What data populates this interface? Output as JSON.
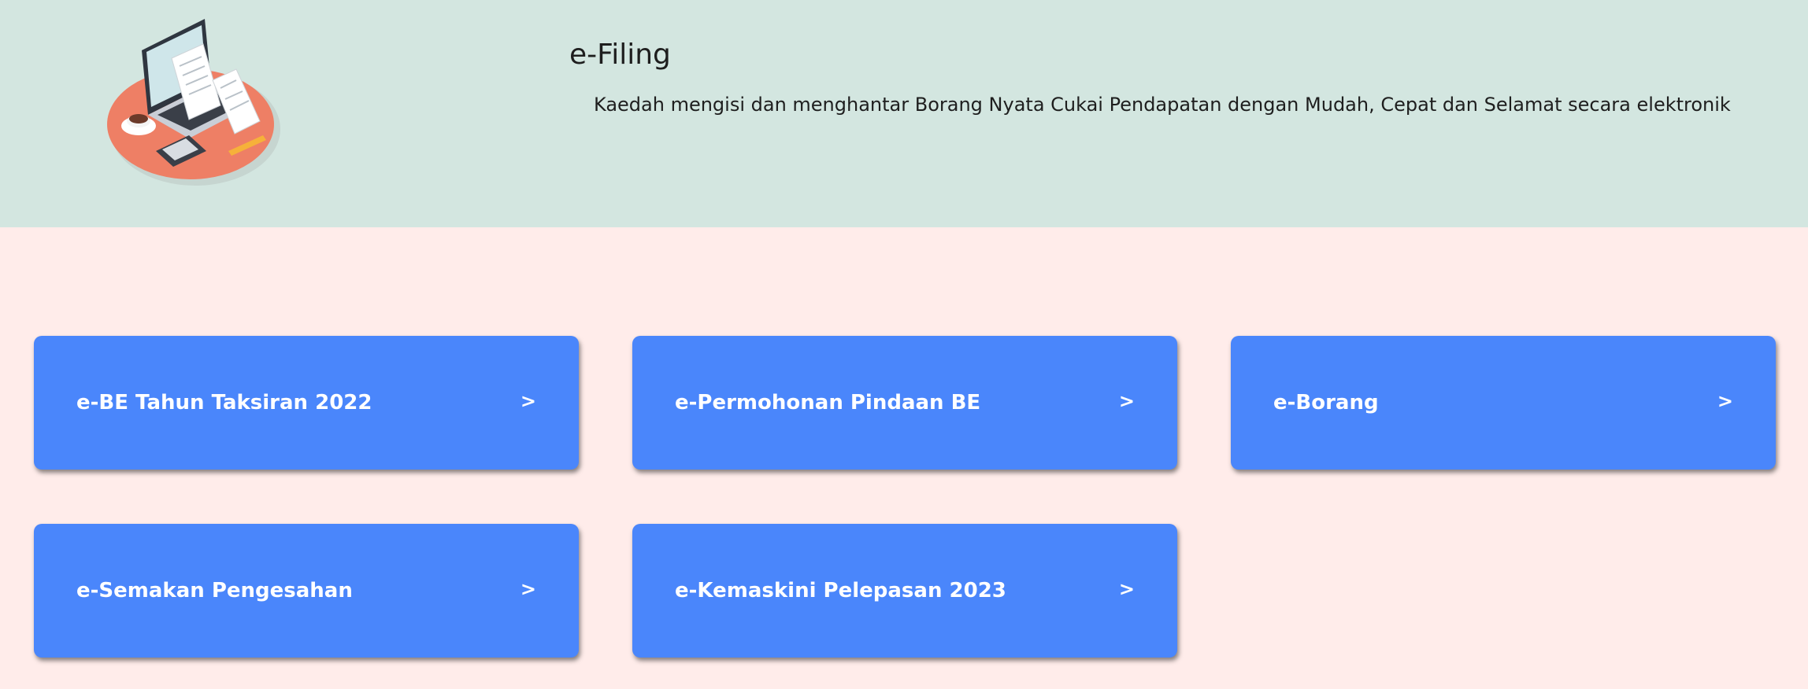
{
  "header": {
    "title": "e-Filing",
    "subtitle": "Kaedah mengisi dan menghantar Borang Nyata Cukai Pendapatan dengan Mudah, Cepat dan Selamat secara elektronik",
    "illustration": "tax-filing-laptop-illustration"
  },
  "cards": [
    {
      "label": "e-BE Tahun Taksiran 2022",
      "chevron": ">"
    },
    {
      "label": "e-Permohonan Pindaan BE",
      "chevron": ">"
    },
    {
      "label": "e-Borang",
      "chevron": ">"
    },
    {
      "label": "e-Semakan Pengesahan",
      "chevron": ">"
    },
    {
      "label": "e-Kemaskini Pelepasan 2023",
      "chevron": ">"
    }
  ],
  "colors": {
    "header_bg": "#d3e6e0",
    "page_bg": "#ffecea",
    "card_bg": "#4a86fb",
    "card_text": "#ffffff"
  }
}
